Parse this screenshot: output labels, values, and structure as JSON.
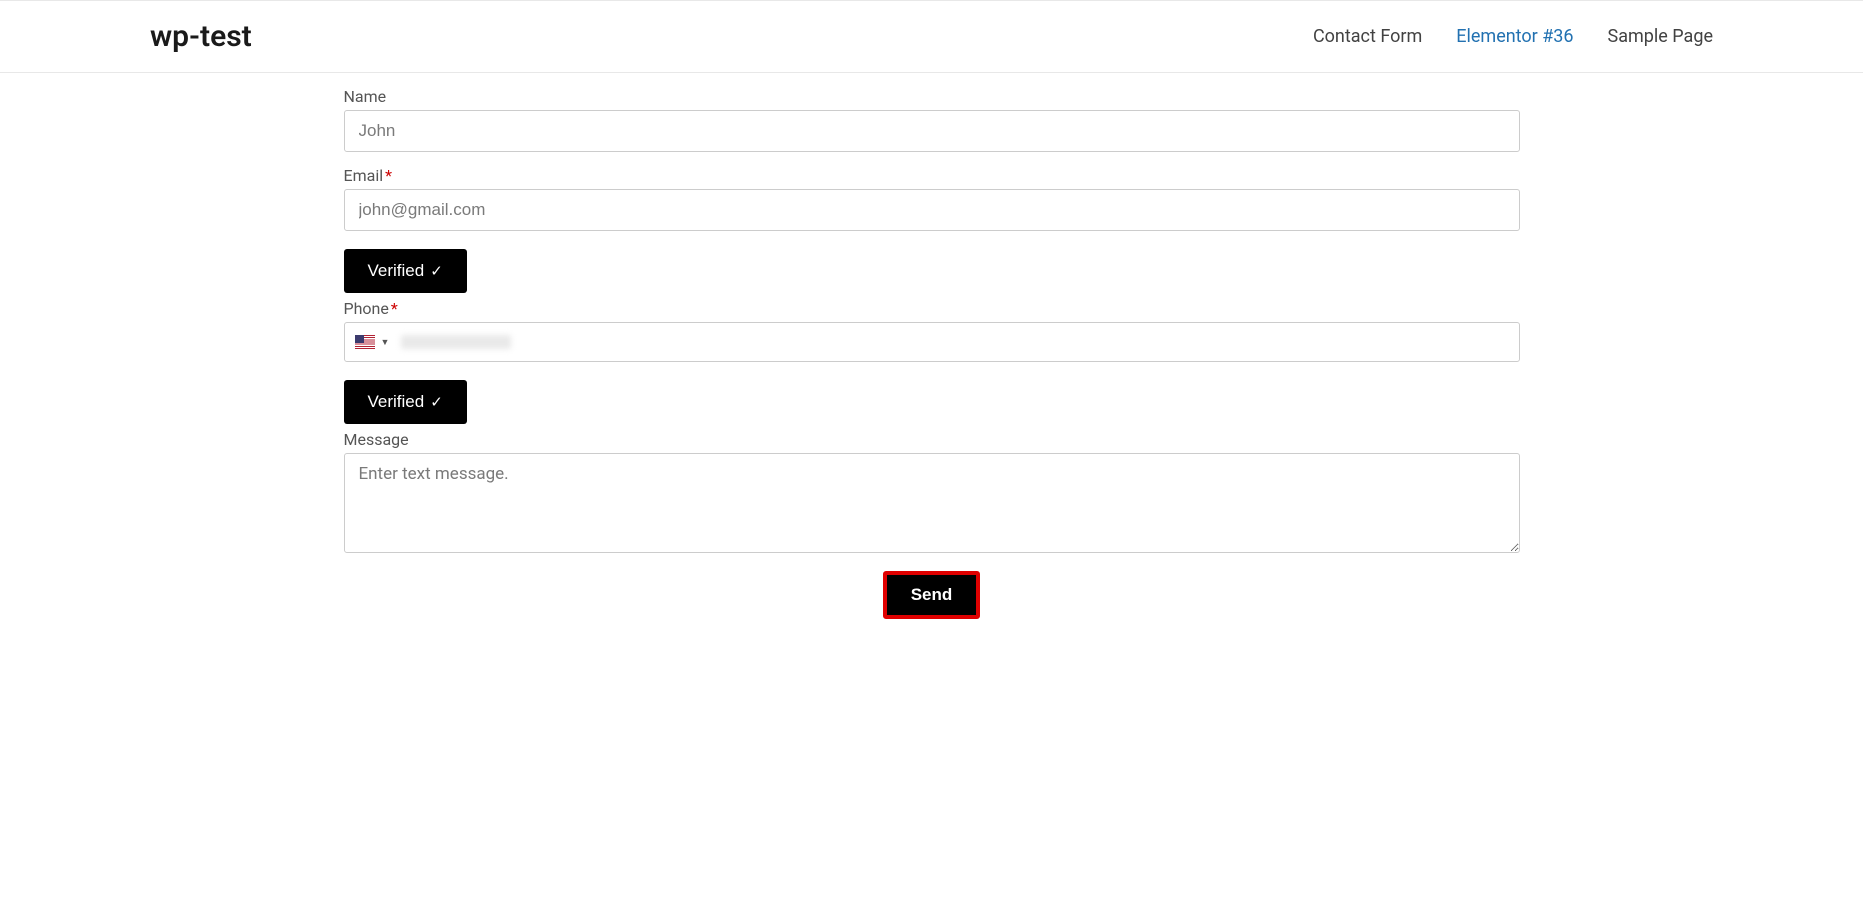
{
  "header": {
    "site_title": "wp-test",
    "nav": [
      {
        "label": "Contact Form",
        "active": false
      },
      {
        "label": "Elementor #36",
        "active": true
      },
      {
        "label": "Sample Page",
        "active": false
      }
    ]
  },
  "form": {
    "name": {
      "label": "Name",
      "placeholder": "John",
      "value": "",
      "required": false
    },
    "email": {
      "label": "Email",
      "placeholder": "john@gmail.com",
      "value": "",
      "required": true
    },
    "email_verify": {
      "label": "Verified",
      "checkmark": "✓"
    },
    "phone": {
      "label": "Phone",
      "value": "",
      "required": true,
      "country": "us"
    },
    "phone_verify": {
      "label": "Verified",
      "checkmark": "✓"
    },
    "message": {
      "label": "Message",
      "placeholder": "Enter text message.",
      "value": ""
    },
    "submit": {
      "label": "Send"
    }
  }
}
